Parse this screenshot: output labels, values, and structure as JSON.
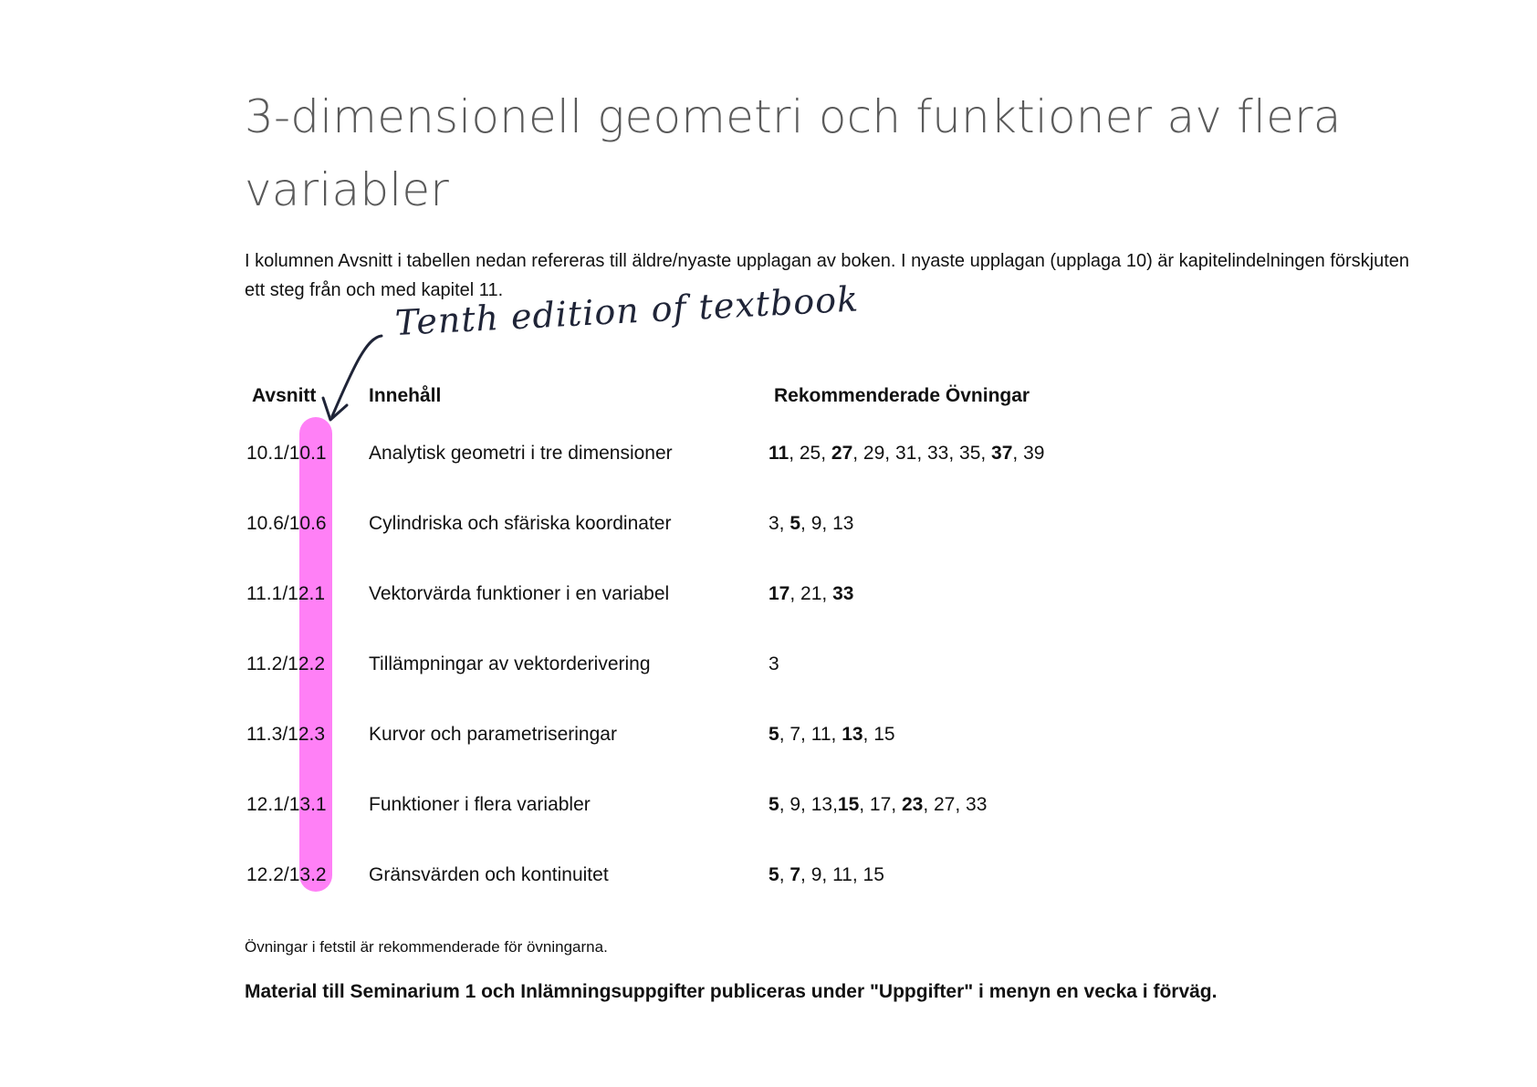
{
  "title": "3-dimensionell geometri och funktioner av flera variabler",
  "intro": "I kolumnen Avsnitt i tabellen nedan refereras till äldre/nyaste upplagan av boken. I nyaste upplagan (upplaga 10) är kapitelindelningen förskjuten ett steg från och med kapitel 11.",
  "annotation": {
    "text": "Tenth edition of textbook",
    "highlight_color": "#ff6ef5",
    "ink_color": "#1f2437"
  },
  "table": {
    "headers": [
      "Avsnitt",
      "Innehåll",
      "Rekommenderade Övningar"
    ],
    "rows": [
      {
        "section": "10.1/10.1",
        "content": "Analytisk geometri i tre dimensioner",
        "exercises": [
          {
            "t": "11",
            "b": true
          },
          {
            "t": ", 25, ",
            "b": false
          },
          {
            "t": "27",
            "b": true
          },
          {
            "t": ", 29, 31, 33, 35, ",
            "b": false
          },
          {
            "t": "37",
            "b": true
          },
          {
            "t": ", 39",
            "b": false
          }
        ]
      },
      {
        "section": "10.6/10.6",
        "content": "Cylindriska och sfäriska koordinater",
        "exercises": [
          {
            "t": "3, ",
            "b": false
          },
          {
            "t": "5",
            "b": true
          },
          {
            "t": ", 9, 13",
            "b": false
          }
        ]
      },
      {
        "section": "11.1/12.1",
        "content": "Vektorvärda funktioner i en variabel",
        "exercises": [
          {
            "t": "17",
            "b": true
          },
          {
            "t": ", 21, ",
            "b": false
          },
          {
            "t": "33",
            "b": true
          }
        ]
      },
      {
        "section": "11.2/12.2",
        "content": "Tillämpningar av vektorderivering",
        "exercises": [
          {
            "t": "3",
            "b": false
          }
        ]
      },
      {
        "section": "11.3/12.3",
        "content": "Kurvor och parametriseringar",
        "exercises": [
          {
            "t": "5",
            "b": true
          },
          {
            "t": ", 7, 11, ",
            "b": false
          },
          {
            "t": "13",
            "b": true
          },
          {
            "t": ", 15",
            "b": false
          }
        ]
      },
      {
        "section": "12.1/13.1",
        "content": "Funktioner i flera variabler",
        "exercises": [
          {
            "t": "5",
            "b": true
          },
          {
            "t": ", 9, 13,",
            "b": false
          },
          {
            "t": "15",
            "b": true
          },
          {
            "t": ", 17, ",
            "b": false
          },
          {
            "t": "23",
            "b": true
          },
          {
            "t": ", 27, 33",
            "b": false
          }
        ]
      },
      {
        "section": "12.2/13.2",
        "content": "Gränsvärden och kontinuitet",
        "exercises": [
          {
            "t": "5",
            "b": true
          },
          {
            "t": ", ",
            "b": false
          },
          {
            "t": "7",
            "b": true
          },
          {
            "t": ", 9, 11, 15",
            "b": false
          }
        ]
      }
    ]
  },
  "footnote": "Övningar i fetstil är rekommenderade för övningarna.",
  "notice": "Material till Seminarium 1 och Inlämningsuppgifter publiceras under \"Uppgifter\" i menyn en vecka i förväg."
}
